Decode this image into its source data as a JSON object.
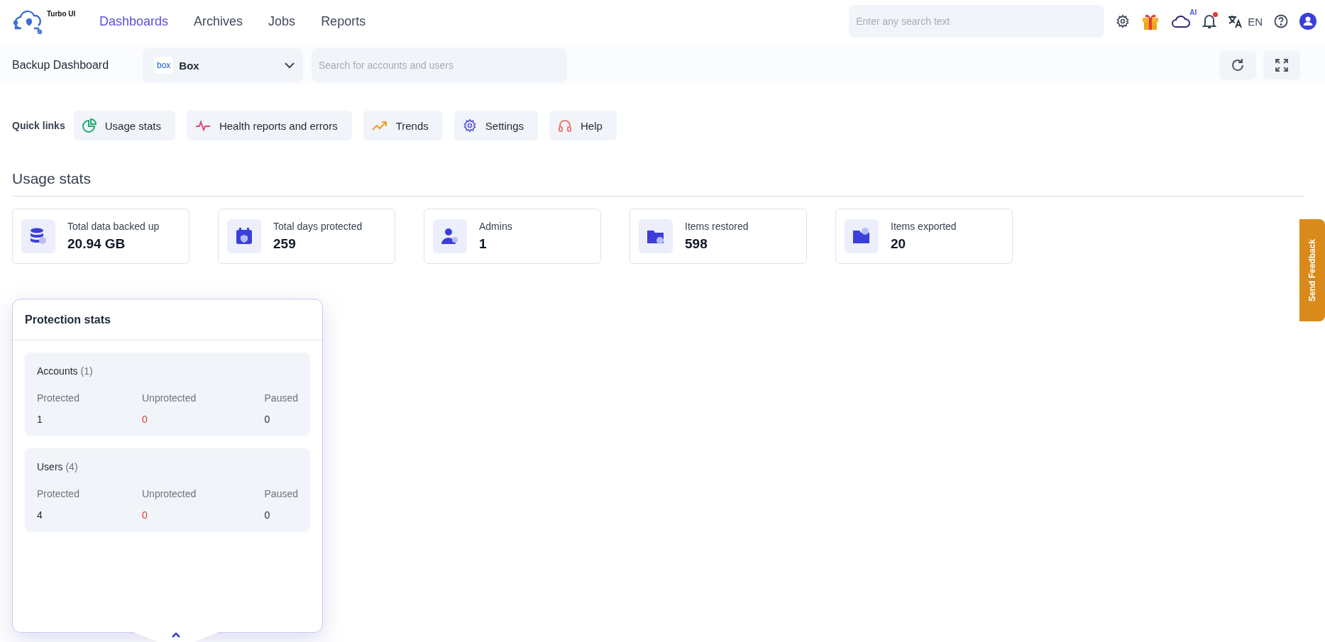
{
  "app": {
    "name": "Turbo UI"
  },
  "nav": [
    {
      "label": "Dashboards",
      "selected": true
    },
    {
      "label": "Archives",
      "selected": false
    },
    {
      "label": "Jobs",
      "selected": false
    },
    {
      "label": "Reports",
      "selected": false
    }
  ],
  "global_search": {
    "placeholder": "Enter any search text"
  },
  "header_tools": {
    "ai_badge": "AI",
    "notifications_unread": true,
    "language": "EN"
  },
  "toolbar": {
    "title": "Backup Dashboard",
    "service": {
      "logo": "box",
      "value": "Box"
    },
    "search": {
      "placeholder": "Search for accounts and users"
    }
  },
  "quick_links": {
    "label": "Quick links",
    "items": [
      {
        "kind": "usage",
        "label": "Usage stats"
      },
      {
        "kind": "health",
        "label": "Health reports and errors"
      },
      {
        "kind": "trends",
        "label": "Trends"
      },
      {
        "kind": "settings",
        "label": "Settings"
      },
      {
        "kind": "help",
        "label": "Help"
      }
    ]
  },
  "usage_stats": {
    "title": "Usage stats",
    "cards": [
      {
        "kind": "data",
        "label": "Total data backed up",
        "value": "20.94 GB"
      },
      {
        "kind": "days",
        "label": "Total days protected",
        "value": "259"
      },
      {
        "kind": "admins",
        "label": "Admins",
        "value": "1"
      },
      {
        "kind": "restored",
        "label": "Items restored",
        "value": "598"
      },
      {
        "kind": "exported",
        "label": "Items exported",
        "value": "20"
      }
    ]
  },
  "protection_stats": {
    "title": "Protection stats",
    "groups": [
      {
        "name": "Accounts",
        "count": "(1)",
        "stats": [
          {
            "label": "Protected",
            "value": "1",
            "warning": false
          },
          {
            "label": "Unprotected",
            "value": "0",
            "warning": true
          },
          {
            "label": "Paused",
            "value": "0",
            "warning": false
          }
        ]
      },
      {
        "name": "Users",
        "count": "(4)",
        "stats": [
          {
            "label": "Protected",
            "value": "4",
            "warning": false
          },
          {
            "label": "Unprotected",
            "value": "0",
            "warning": true
          },
          {
            "label": "Paused",
            "value": "0",
            "warning": false
          }
        ]
      }
    ]
  },
  "feedback_tab": {
    "label": "Send Feedback"
  }
}
